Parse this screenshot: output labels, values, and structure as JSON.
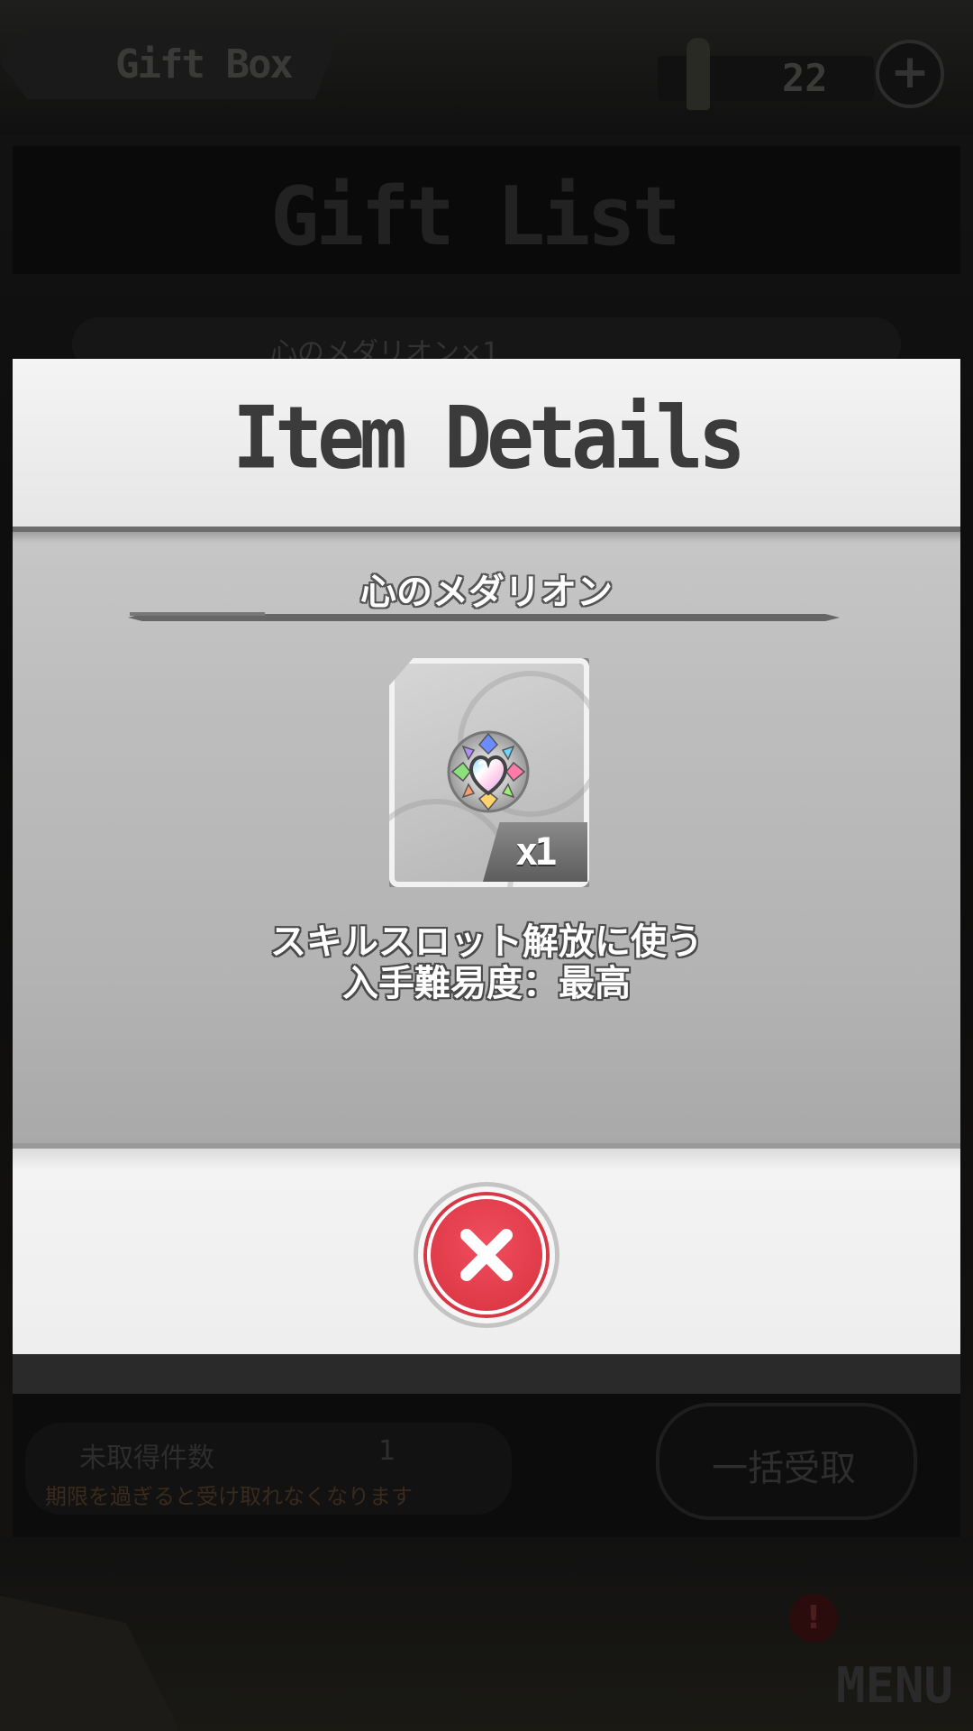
{
  "background": {
    "header_title": "Gift Box",
    "currency_count": "22",
    "plus_label": "+",
    "panel_title": "Gift List",
    "list_item_text": "心のメダリオン×1",
    "unclaimed_label": "未取得件数",
    "unclaimed_count": "1",
    "expire_note": "期限を過ぎると受け取れなくなります",
    "claim_all_label": "一括受取",
    "alert_badge": "!",
    "menu_label": "MENU"
  },
  "modal": {
    "title": "Item Details",
    "item_name": "心のメダリオン",
    "quantity": "x1",
    "description_line1": "スキルスロット解放に使う",
    "description_line2": "入手難易度：最高",
    "close_icon": "close-x-icon",
    "item_icon": "heart-medallion-icon"
  },
  "colors": {
    "close_button": "#e23d4b",
    "modal_header": "#eeeeee",
    "modal_body": "#b8b8b8",
    "title_text": "#3b3b3b"
  }
}
